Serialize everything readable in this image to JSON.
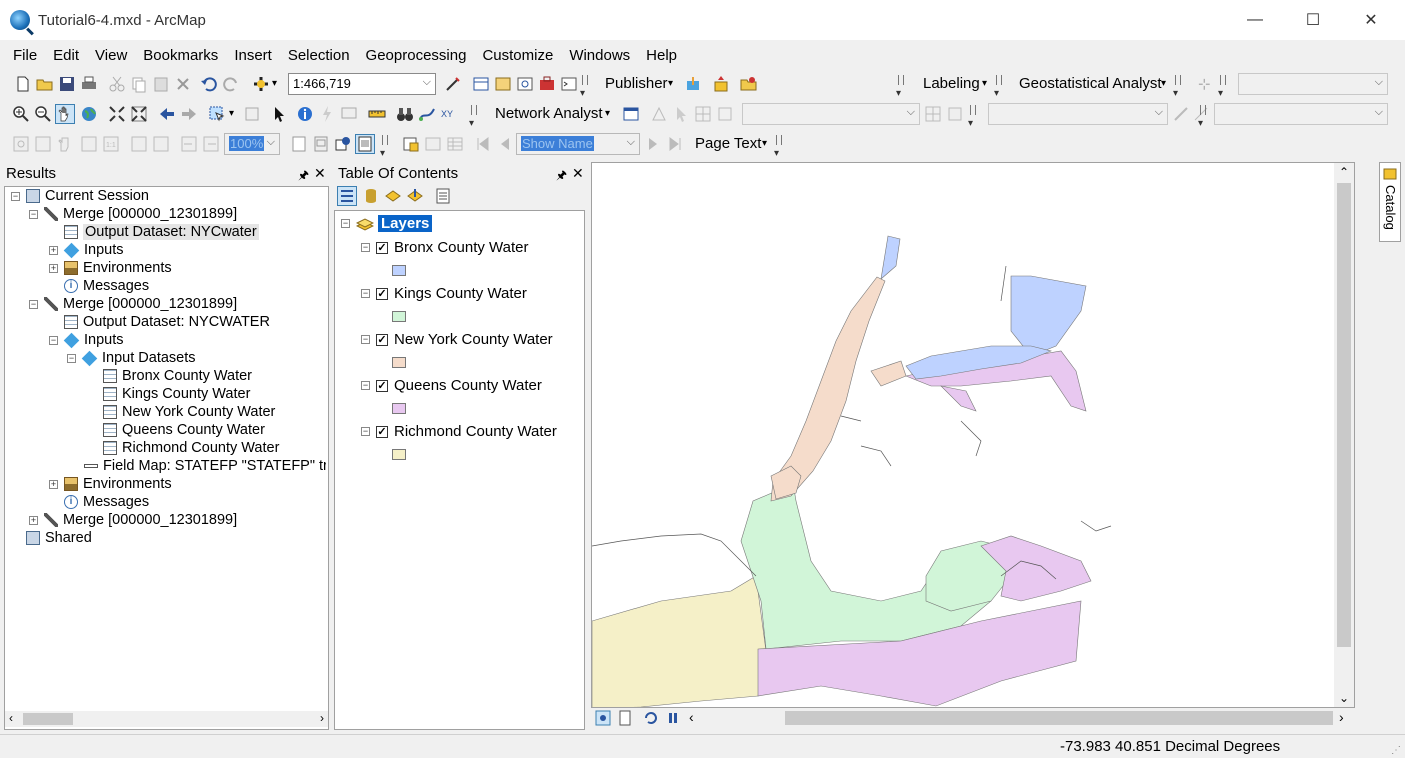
{
  "window": {
    "title": "Tutorial6-4.mxd - ArcMap",
    "minimize": "—",
    "maximize": "☐",
    "close": "✕"
  },
  "menu": [
    "File",
    "Edit",
    "View",
    "Bookmarks",
    "Insert",
    "Selection",
    "Geoprocessing",
    "Customize",
    "Windows",
    "Help"
  ],
  "toolbar": {
    "scale": "1:466,719",
    "publisher": "Publisher",
    "labeling": "Labeling",
    "geostat": "Geostatistical Analyst",
    "network": "Network Analyst",
    "zoom_pct": "100%",
    "show_name": "Show Name",
    "page_text": "Page Text"
  },
  "results": {
    "title": "Results",
    "current_session": "Current Session",
    "merge1": "Merge [000000_12301899]",
    "output1": "Output Dataset: NYCwater",
    "inputs": "Inputs",
    "environments": "Environments",
    "messages": "Messages",
    "merge2": "Merge [000000_12301899]",
    "output2": "Output Dataset: NYCWATER",
    "input_datasets": "Input Datasets",
    "datasets": [
      "Bronx County Water",
      "Kings County Water",
      "New York County Water",
      "Queens County Water",
      "Richmond County Water"
    ],
    "field_map": "Field Map: STATEFP \"STATEFP\" tru",
    "merge3": "Merge [000000_12301899]",
    "shared": "Shared"
  },
  "toc": {
    "title": "Table Of Contents",
    "layers_label": "Layers",
    "layers": [
      {
        "name": "Bronx County Water",
        "color": "#bed2ff"
      },
      {
        "name": "Kings County Water",
        "color": "#d1f5d8"
      },
      {
        "name": "New York County Water",
        "color": "#f5dccb"
      },
      {
        "name": "Queens County Water",
        "color": "#e8c8f0"
      },
      {
        "name": "Richmond County Water",
        "color": "#f5f0c8"
      }
    ]
  },
  "catalog_tab": "Catalog",
  "status": {
    "coords": "-73.983  40.851 Decimal Degrees"
  }
}
